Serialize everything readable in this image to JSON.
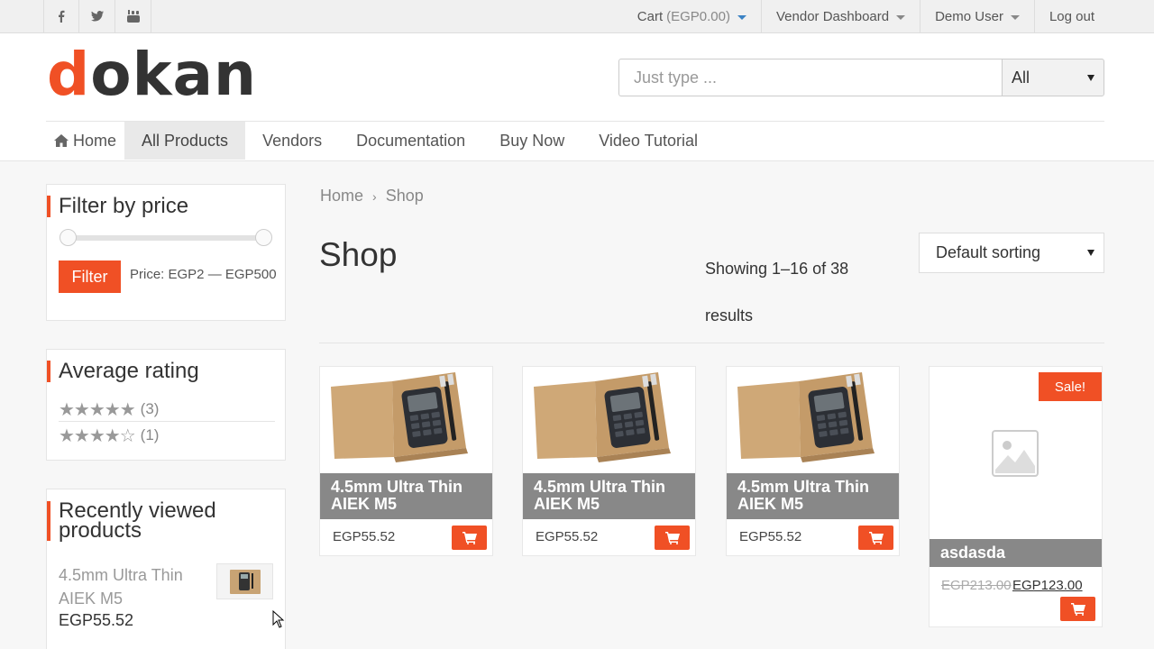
{
  "topbar": {
    "social": [
      "facebook-icon",
      "twitter-icon",
      "youtube-icon"
    ],
    "cart_label": "Cart",
    "cart_amount": "(EGP0.00)",
    "vendor_dashboard": "Vendor Dashboard",
    "user": "Demo User",
    "logout": "Log out"
  },
  "header": {
    "logo_first": "d",
    "logo_rest": "okan",
    "search_placeholder": "Just type ...",
    "search_category": "All"
  },
  "nav": {
    "home": "Home",
    "items": [
      "All Products",
      "Vendors",
      "Documentation",
      "Buy Now",
      "Video Tutorial"
    ]
  },
  "sidebar": {
    "filter_title": "Filter by price",
    "filter_button": "Filter",
    "price_range": "Price: EGP2 — EGP500",
    "rating_title": "Average rating",
    "ratings": [
      {
        "stars": 5,
        "count": "(3)"
      },
      {
        "stars": 4,
        "count": "(1)"
      }
    ],
    "recent_title_1": "Recently viewed",
    "recent_title_2": "products",
    "recent_name": "4.5mm Ultra Thin AIEK M5",
    "recent_price": "EGP55.52"
  },
  "main": {
    "breadcrumb_home": "Home",
    "breadcrumb_current": "Shop",
    "title": "Shop",
    "showing": "Showing 1–16 of 38 results",
    "sorting": "Default sorting",
    "products": [
      {
        "title": "4.5mm Ultra Thin AIEK M5",
        "price": "EGP55.52"
      },
      {
        "title": "4.5mm Ultra Thin AIEK M5",
        "price": "EGP55.52"
      },
      {
        "title": "4.5mm Ultra Thin AIEK M5",
        "price": "EGP55.52"
      }
    ],
    "sale_product": {
      "badge": "Sale!",
      "title": "asdasda",
      "old_price": "EGP213.00",
      "new_price": "EGP123.00"
    }
  },
  "colors": {
    "accent": "#f05025",
    "title_bar": "#888888"
  }
}
